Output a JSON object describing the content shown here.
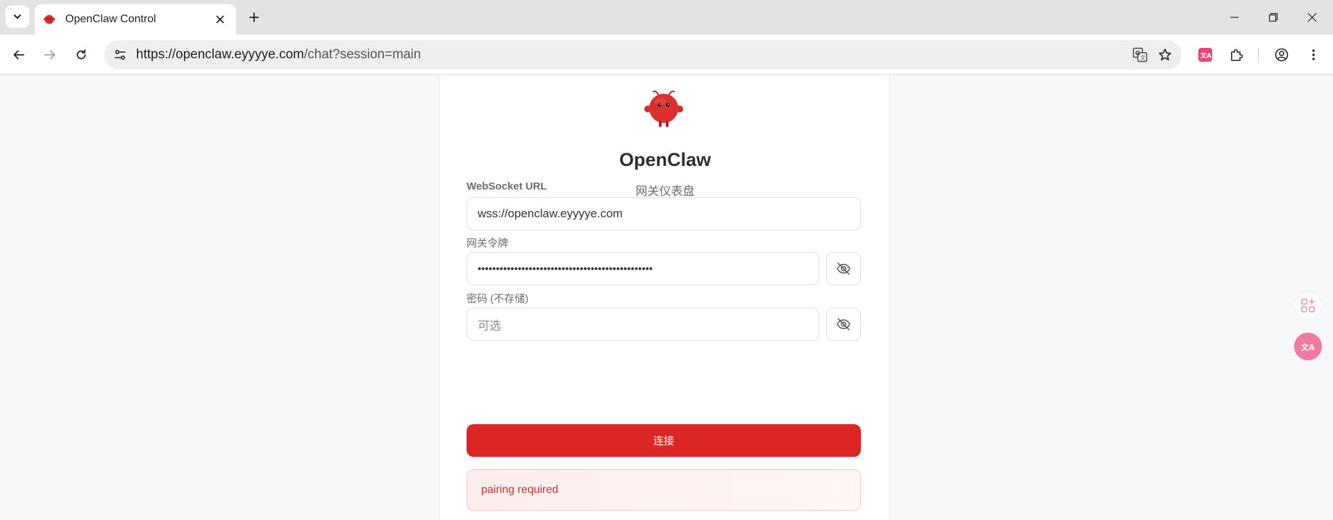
{
  "browser": {
    "tab": {
      "title": "OpenClaw Control"
    },
    "address": {
      "host": "https://openclaw.eyyyye.com",
      "path": "/chat?session=main"
    }
  },
  "page": {
    "brand": "OpenClaw",
    "subtitle": "网关仪表盘",
    "ws_label": "WebSocket URL",
    "ws_value": "wss://openclaw.eyyyye.com",
    "token_label": "网关令牌",
    "token_mask": "••••••••••••••••••••••••••••••••••••••••••••••••",
    "password_label": "密码 (不存储)",
    "password_placeholder": "可选",
    "connect_label": "连接",
    "error_text": "pairing required"
  },
  "colors": {
    "accent": "#dc2626",
    "error_text": "#c53030"
  }
}
